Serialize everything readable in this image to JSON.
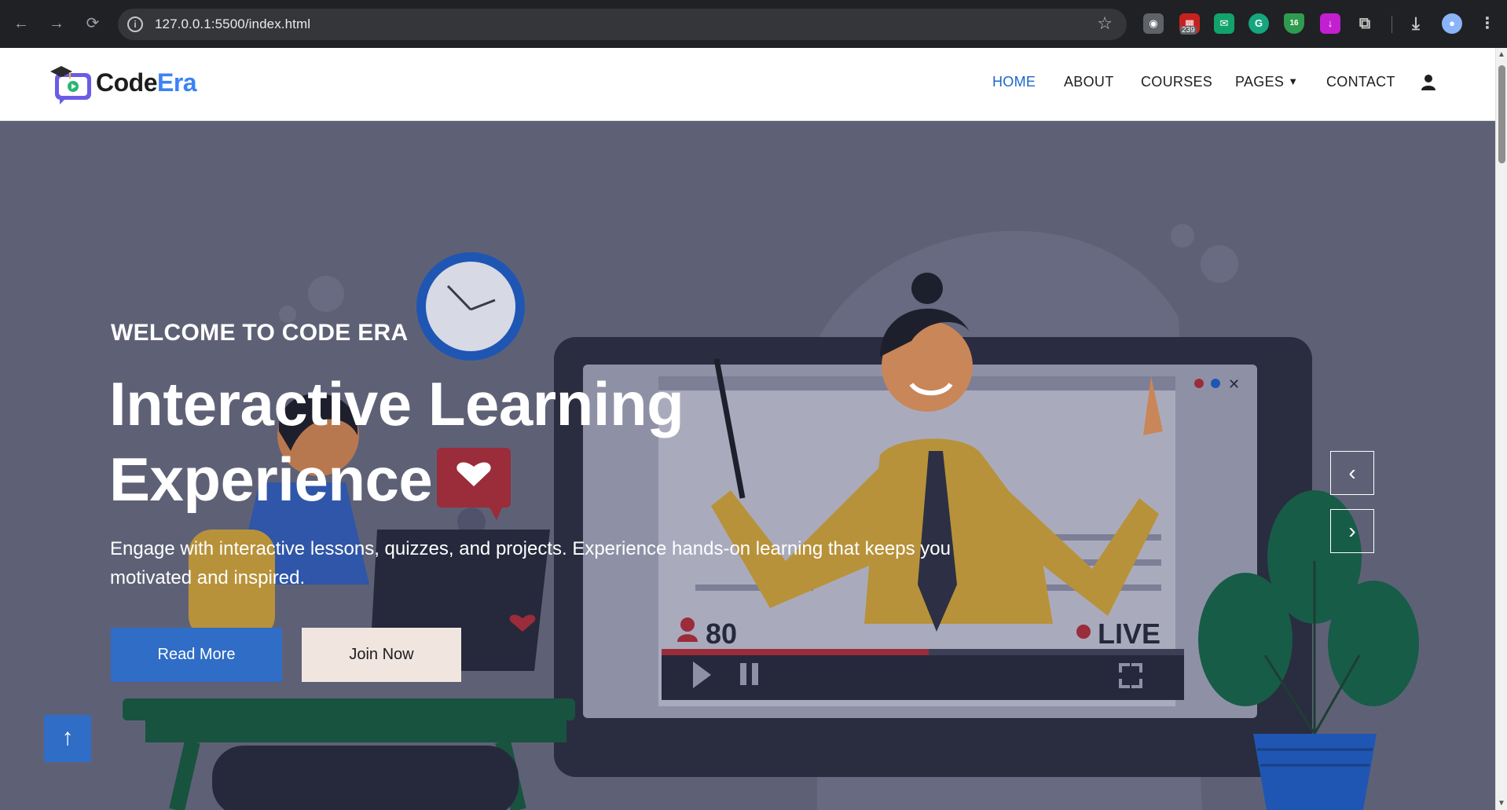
{
  "browser": {
    "url": "127.0.0.1:5500/index.html",
    "calendar_badge": "239",
    "shield_badge": "16"
  },
  "site": {
    "brand_main": "Code",
    "brand_accent": "Era",
    "nav": {
      "home": "HOME",
      "about": "ABOUT",
      "courses": "COURSES",
      "pages": "PAGES",
      "contact": "CONTACT"
    }
  },
  "hero": {
    "welcome": "WELCOME TO CODE ERA",
    "title_line1": "Interactive Learning",
    "title_line2": "Experience",
    "description": "Engage with interactive lessons, quizzes, and projects. Experience hands-on learning that keeps you motivated and inspired.",
    "read_more": "Read More",
    "join_now": "Join Now",
    "viewer_count": "80",
    "live_label": "LIVE"
  },
  "colors": {
    "accent": "#2f6dc6",
    "overlay": "#5e6176",
    "brand_accent": "#3b82f6"
  }
}
